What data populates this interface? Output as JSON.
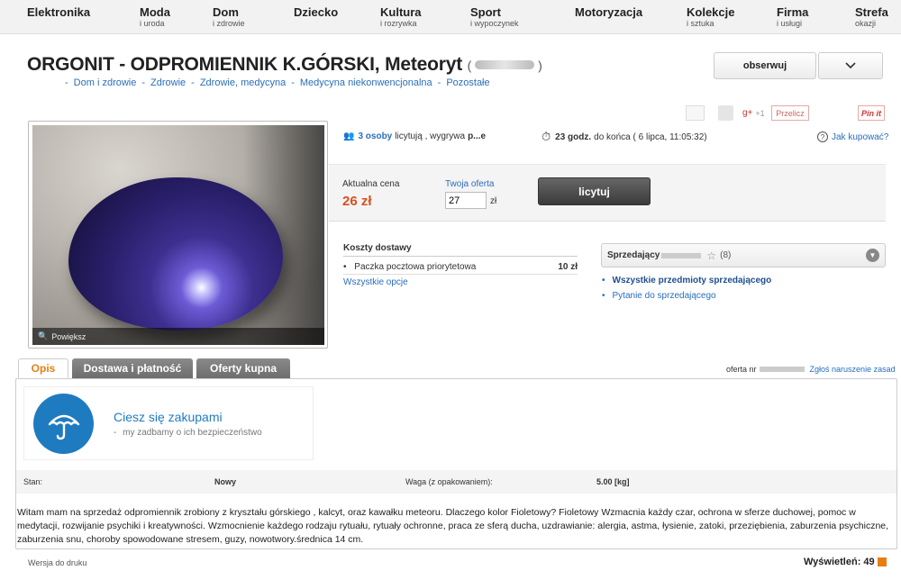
{
  "nav": [
    {
      "title": "Elektronika",
      "sub": ""
    },
    {
      "title": "Moda",
      "sub": "i uroda"
    },
    {
      "title": "Dom",
      "sub": "i zdrowie"
    },
    {
      "title": "Dziecko",
      "sub": ""
    },
    {
      "title": "Kultura",
      "sub": "i rozrywka"
    },
    {
      "title": "Sport",
      "sub": "i wypoczynek"
    },
    {
      "title": "Motoryzacja",
      "sub": ""
    },
    {
      "title": "Kolekcje",
      "sub": "i sztuka"
    },
    {
      "title": "Firma",
      "sub": "i usługi"
    },
    {
      "title": "Strefa",
      "sub": "okazji"
    }
  ],
  "title": "ORGONIT - ODPROMIENNIK K.GÓRSKI, Meteoryt",
  "title_paren_open": "(",
  "title_paren_close": ")",
  "breadcrumb": [
    "Dom i zdrowie",
    "Zdrowie",
    "Zdrowie, medycyna",
    "Medycyna niekonwencjonalna",
    "Pozostałe"
  ],
  "breadcrumb_sep": "-",
  "watch_label": "obserwuj",
  "share": {
    "gplus": "g+",
    "plusone": "+1",
    "przelicz": "Przelicz",
    "pinit": "Pin it"
  },
  "zoom_label": "Powiększ",
  "auction": {
    "bidders_link": "3 osoby",
    "bidders_text": "licytują , wygrywa",
    "winner": "p...e",
    "time_bold": "23 godz.",
    "time_text": "do końca ( 6 lipca, 11:05:32)",
    "howto": "Jak kupować?"
  },
  "bid": {
    "price_label": "Aktualna cena",
    "price_value": "26 zł",
    "offer_label": "Twoja oferta",
    "offer_value": "27",
    "offer_unit": "zł",
    "button": "licytuj"
  },
  "shipping": {
    "header": "Koszty dostawy",
    "method": "Paczka pocztowa priorytetowa",
    "price": "10 zł",
    "options_link": "Wszystkie opcje"
  },
  "seller": {
    "label": "Sprzedający",
    "rating": "(8)",
    "all_items": "Wszystkie przedmioty sprzedającego",
    "ask": "Pytanie do sprzedającego"
  },
  "tabs": [
    "Opis",
    "Dostawa i płatność",
    "Oferty kupna"
  ],
  "offer_nr_label": "oferta nr",
  "report_label": "Zgłoś naruszenie zasad",
  "safe": {
    "title": "Ciesz się zakupami",
    "subtitle": "my zadbamy o ich bezpieczeństwo"
  },
  "params": {
    "stan_label": "Stan:",
    "stan_value": "Nowy",
    "waga_label": "Waga (z opakowaniem):",
    "waga_value": "5.00 [kg]"
  },
  "description": "Witam mam na sprzedaż odpromiennik zrobiony z kryształu górskiego , kalcyt, oraz kawałku meteoru. Dlaczego kolor Fioletowy? Fioletowy Wzmacnia każdy czar, ochrona w sferze duchowej, pomoc w medytacji, rozwijanie psychiki i kreatywności. Wzmocnienie każdego rodzaju rytuału, rytuały ochronne, praca ze sferą ducha, uzdrawianie: alergia, astma, łysienie, zatoki, przeziębienia, zaburzenia psychiczne, zaburzenia snu, choroby spowodowane stresem, guzy, nowotwory.średnica 14 cm.",
  "footer": {
    "print": "Wersja do druku",
    "views": "Wyświetleń: 49"
  },
  "colors": {
    "accent": "#e87e13",
    "link": "#2a6ebb",
    "price": "#d9511c",
    "umbrella": "#1f7bc0"
  }
}
